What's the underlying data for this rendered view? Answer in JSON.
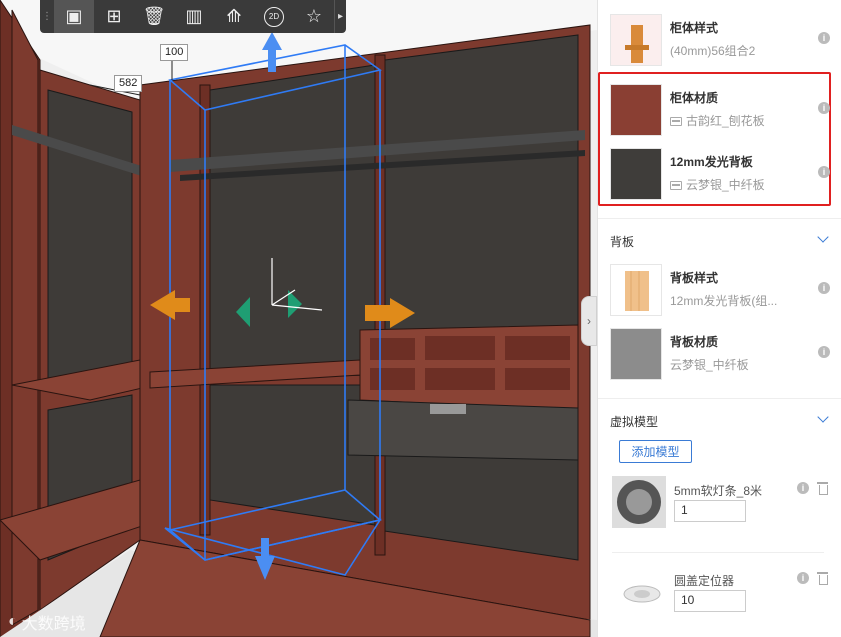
{
  "toolbar": {
    "buttons": [
      {
        "icon": "select-box-icon"
      },
      {
        "icon": "add-copy-icon"
      },
      {
        "icon": "delete-icon"
      },
      {
        "icon": "grid-layout-icon"
      },
      {
        "icon": "measure-icon"
      },
      {
        "icon": "2d-icon",
        "label": "2D"
      },
      {
        "icon": "star-icon"
      }
    ]
  },
  "viewport": {
    "dim_height": "100",
    "dim_depth": "582",
    "watermark": "大数跨境"
  },
  "panel": {
    "body_style": {
      "title": "柜体样式",
      "subtitle": "(40mm)56组合2"
    },
    "body_material": {
      "title": "柜体材质",
      "subtitle": "古韵红_刨花板",
      "swatch": "#8a3f33"
    },
    "back_panel_mat": {
      "title": "12mm发光背板",
      "subtitle": "云梦银_中纤板",
      "swatch": "#3f3d3a"
    },
    "back_section": {
      "title": "背板"
    },
    "back_style": {
      "title": "背板样式",
      "subtitle": "12mm发光背板(组..."
    },
    "back_material": {
      "title": "背板材质",
      "subtitle": "云梦银_中纤板",
      "swatch": "#8c8c8c"
    },
    "virtual_section": {
      "title": "虚拟模型",
      "add_button": "添加模型"
    },
    "models": [
      {
        "name": "5mm软灯条_8米",
        "qty": "1"
      },
      {
        "name": "圆盖定位器",
        "qty": "10"
      }
    ]
  },
  "colors": {
    "accent": "#3a7bd5",
    "highlight": "#e02020",
    "wood_red": "#7d3a2e"
  }
}
